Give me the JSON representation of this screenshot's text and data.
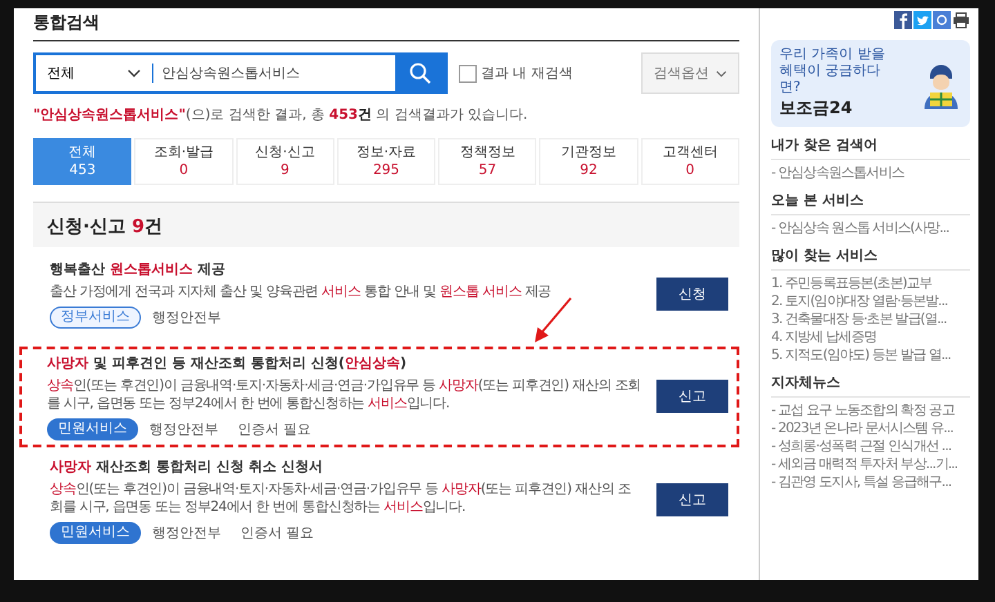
{
  "page_title": "통합검색",
  "search": {
    "scope": "전체",
    "value": "안심상속원스톱서비스",
    "refine": {
      "label": "결과 내 재검색",
      "checked": false
    },
    "options_button": "검색옵션"
  },
  "result_summary": [
    {
      "text": "\"안심상속원스톱서비스\"",
      "highlight": true
    },
    {
      "text": "(으)로 검색한 결과, 총 ",
      "highlight": false
    },
    {
      "text": "453",
      "highlight": true
    },
    {
      "text": "건",
      "highlight": false,
      "bold": true
    },
    {
      "text": " 의 검색결과가 있습니다.",
      "highlight": false
    }
  ],
  "tabs": [
    {
      "label": "전체",
      "count": "453",
      "selected": true
    },
    {
      "label": "조회·발급",
      "count": "0",
      "selected": false
    },
    {
      "label": "신청·신고",
      "count": "9",
      "selected": false
    },
    {
      "label": "정보·자료",
      "count": "295",
      "selected": false
    },
    {
      "label": "정책정보",
      "count": "57",
      "selected": false
    },
    {
      "label": "기관정보",
      "count": "92",
      "selected": false
    },
    {
      "label": "고객센터",
      "count": "0",
      "selected": false
    }
  ],
  "section": {
    "title": "신청·신고",
    "count": "9",
    "unit": "건"
  },
  "results": [
    {
      "marked": false,
      "title": [
        {
          "text": "행복출산 ",
          "highlight": false
        },
        {
          "text": "원스톱서비스",
          "highlight": true
        },
        {
          "text": " 제공",
          "highlight": false
        }
      ],
      "description": [
        {
          "text": "출산 가정에게 전국과 지자체 출산 및 양육관련 ",
          "highlight": false
        },
        {
          "text": "서비스",
          "highlight": true
        },
        {
          "text": " 통합 안내 및 ",
          "highlight": false
        },
        {
          "text": "원스톱 서비스",
          "highlight": true
        },
        {
          "text": " 제공",
          "highlight": false
        }
      ],
      "tag": {
        "label": "정부서비스",
        "kind": "outline"
      },
      "agency": "행정안전부",
      "button": "신청"
    },
    {
      "marked": true,
      "title": [
        {
          "text": "사망자",
          "highlight": true
        },
        {
          "text": " 및 피후견인 등 재산조회 통합처리 신청(",
          "highlight": false
        },
        {
          "text": "안심상속",
          "highlight": true
        },
        {
          "text": ")",
          "highlight": false
        }
      ],
      "description": [
        {
          "text": "상속",
          "highlight": true
        },
        {
          "text": "인(또는 후견인)이 금융내역·토지·자동차·세금·연금·가입유무 등 ",
          "highlight": false
        },
        {
          "text": "사망자",
          "highlight": true
        },
        {
          "text": "(또는 피후견인) 재산의 조회를 시구, 읍면동 또는 정부24에서 한 번에 통합신청하는 ",
          "highlight": false
        },
        {
          "text": "서비스",
          "highlight": true
        },
        {
          "text": "입니다.",
          "highlight": false
        }
      ],
      "tag": {
        "label": "민원서비스",
        "kind": "filled"
      },
      "agency": "행정안전부",
      "note": "인증서 필요",
      "button": "신고"
    },
    {
      "marked": false,
      "title": [
        {
          "text": "사망자",
          "highlight": true
        },
        {
          "text": " 재산조회 통합처리 신청 취소 신청서",
          "highlight": false
        }
      ],
      "description": [
        {
          "text": "상속",
          "highlight": true
        },
        {
          "text": "인(또는 후견인)이 금융내역·토지·자동차·세금·연금·가입유무 등 ",
          "highlight": false
        },
        {
          "text": "사망자",
          "highlight": true
        },
        {
          "text": "(또는 피후견인) 재산의 조회를 시구, 읍면동 또는 정부24에서 한 번에 통합신청하는 ",
          "highlight": false
        },
        {
          "text": "서비스",
          "highlight": true
        },
        {
          "text": "입니다.",
          "highlight": false
        }
      ],
      "tag": {
        "label": "민원서비스",
        "kind": "filled"
      },
      "agency": "행정안전부",
      "note": "인증서 필요",
      "button": "신고"
    }
  ],
  "sidebar": {
    "banner": {
      "caption": "우리 가족이 받을 혜택이 궁금하다면?",
      "title": "보조금24"
    },
    "sections": [
      {
        "title": "내가 찾은 검색어",
        "items": [
          "- 안심상속원스톱서비스"
        ]
      },
      {
        "title": "오늘 본 서비스",
        "items": [
          "- 안심상속 원스톱 서비스(사망..."
        ]
      },
      {
        "title": "많이 찾는 서비스",
        "items": [
          "1. 주민등록표등본(초본)교부",
          "2. 토지(임야)대장 열람·등본발...",
          "3. 건축물대장 등·초본 발급(열...",
          "4. 지방세 납세증명",
          "5. 지적도(임야도) 등본 발급 열..."
        ]
      },
      {
        "title": "지자체뉴스",
        "items": [
          "- 교섭 요구 노동조합의 확정 공고",
          "- 2023년 온나라 문서시스템 유...",
          "- 성희롱·성폭력 근절 인식개선 ...",
          "- 세외금 매력적 투자처 부상...기...",
          "- 김관영 도지사, 특설 응급해구..."
        ]
      }
    ]
  }
}
